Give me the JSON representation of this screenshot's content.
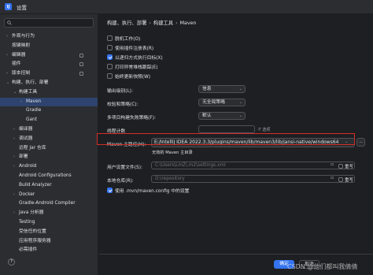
{
  "window": {
    "app_icon": "IJ",
    "title": "设置"
  },
  "sidebar": {
    "search_placeholder": "",
    "items": [
      {
        "label": "外观与行为",
        "indent": 0,
        "arrow": "›"
      },
      {
        "label": "按键映射",
        "indent": 0,
        "arrow": ""
      },
      {
        "label": "编辑器",
        "indent": 0,
        "arrow": "›"
      },
      {
        "label": "插件",
        "indent": 0,
        "arrow": ""
      },
      {
        "label": "版本控制",
        "indent": 0,
        "arrow": "›"
      },
      {
        "label": "构建、执行、部署",
        "indent": 0,
        "arrow": "⌄"
      },
      {
        "label": "构建工具",
        "indent": 1,
        "arrow": "⌄"
      },
      {
        "label": "Maven",
        "indent": 2,
        "arrow": "›",
        "selected": true
      },
      {
        "label": "Gradle",
        "indent": 2,
        "arrow": ""
      },
      {
        "label": "Gant",
        "indent": 2,
        "arrow": ""
      },
      {
        "label": "编译器",
        "indent": 1,
        "arrow": "›"
      },
      {
        "label": "调试器",
        "indent": 1,
        "arrow": "›"
      },
      {
        "label": "远程 Jar 仓库",
        "indent": 1,
        "arrow": ""
      },
      {
        "label": "部署",
        "indent": 1,
        "arrow": "›"
      },
      {
        "label": "Android",
        "indent": 1,
        "arrow": "›"
      },
      {
        "label": "Android Configurations",
        "indent": 1,
        "arrow": ""
      },
      {
        "label": "Build Analyzer",
        "indent": 1,
        "arrow": ""
      },
      {
        "label": "Docker",
        "indent": 1,
        "arrow": "›"
      },
      {
        "label": "Gradle-Android Compiler",
        "indent": 1,
        "arrow": ""
      },
      {
        "label": "Java 分析器",
        "indent": 1,
        "arrow": "›"
      },
      {
        "label": "Testing",
        "indent": 1,
        "arrow": ""
      },
      {
        "label": "受信任的位置",
        "indent": 1,
        "arrow": ""
      },
      {
        "label": "应用程序服务器",
        "indent": 1,
        "arrow": ""
      },
      {
        "label": "必需插件",
        "indent": 1,
        "arrow": ""
      }
    ]
  },
  "breadcrumb": {
    "part1": "构建、执行、部署",
    "part2": "构建工具",
    "part3": "Maven",
    "sep": "›"
  },
  "options": {
    "offline": "脱机工作(O)",
    "use_plugin_registry": "使用插件注册表(R)",
    "recursive": "以递归方式执行目标(X)",
    "print_stack": "打印异常堆栈跟踪(E)",
    "always_update": "始终更新快照(W)"
  },
  "fields": {
    "output_level_label": "输出级别(L):",
    "output_level_value": "信息",
    "checksum_label": "校验和策略(C):",
    "checksum_value": "无全局策略",
    "multiproject_label": "多项目构建失败策略(F):",
    "multiproject_value": "默认",
    "threads_label": "线程计数",
    "threads_hint": "-T 选项",
    "maven_home_label": "Maven 主路径(H):",
    "maven_home_value": "E:/IntelliJ IDEA 2022.3.3/plugins/maven/lib/maven3/lib/jansi-native/windows64",
    "maven_home_error": "无效的 Maven 主目录",
    "settings_label": "用户设置文件(S):",
    "settings_value": "C:\\Users\\LmZ\\.m2\\settings.xml",
    "repo_label": "本地仓库(R):",
    "repo_value": "D:\\repository",
    "override_label": "重写",
    "use_mvn_config": "使用 .mvn/maven.config 中的设置",
    "browse": "..."
  },
  "buttons": {
    "ok": "确定",
    "cancel": "取消"
  },
  "help": "?",
  "watermark": "CSDN @他们都叫我倩倩"
}
